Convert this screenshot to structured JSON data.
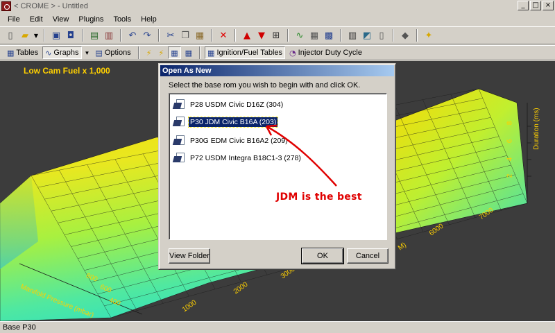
{
  "window": {
    "title": "< CROME > - Untitled",
    "minimize_glyph": "_",
    "maximize_glyph": "□",
    "close_glyph": "×"
  },
  "menu": {
    "items": [
      "File",
      "Edit",
      "View",
      "Plugins",
      "Tools",
      "Help"
    ]
  },
  "toolbar2": {
    "tables_label": "Tables",
    "graphs_label": "Graphs",
    "options_label": "Options",
    "ignition_fuel_label": "Ignition/Fuel Tables",
    "injector_duty_label": "Injector Duty Cycle"
  },
  "graph": {
    "title": "Low Cam Fuel x 1,000",
    "left_axis_label": "Manifold Pressure (mbar)",
    "left_axis_ticks": [
      "400",
      "600",
      "800"
    ],
    "bottom_axis_ticks": [
      "1000",
      "2000",
      "3000",
      "6000",
      "7000"
    ],
    "right_axis_label": "Duration (ms)",
    "right_axis_ticks": [
      "2",
      "4",
      "6",
      "8"
    ],
    "partial_rpm_label": "M)",
    "colors": {
      "background": "#3c3c3c",
      "title": "#ffd000",
      "axis_text": "#ffd000",
      "surface_high": "#ffd700",
      "surface_mid": "#a8f040",
      "surface_low": "#30e0c0"
    }
  },
  "dialog": {
    "title": "Open As New",
    "instruction": "Select the base rom you wish to begin with and click OK.",
    "roms": [
      {
        "label": "P28 USDM Civic D16Z (304)",
        "selected": false
      },
      {
        "label": "P30 JDM Civic B16A (203)",
        "selected": true
      },
      {
        "label": "P30G EDM Civic B16A2 (209)",
        "selected": false
      },
      {
        "label": "P72 USDM Integra B18C1-3 (278)",
        "selected": false
      }
    ],
    "view_folder_label": "View Folder",
    "ok_label": "OK",
    "cancel_label": "Cancel"
  },
  "annotation": {
    "text": "JDM is the best",
    "color": "#e00000"
  },
  "status": {
    "text": "Base P30"
  }
}
